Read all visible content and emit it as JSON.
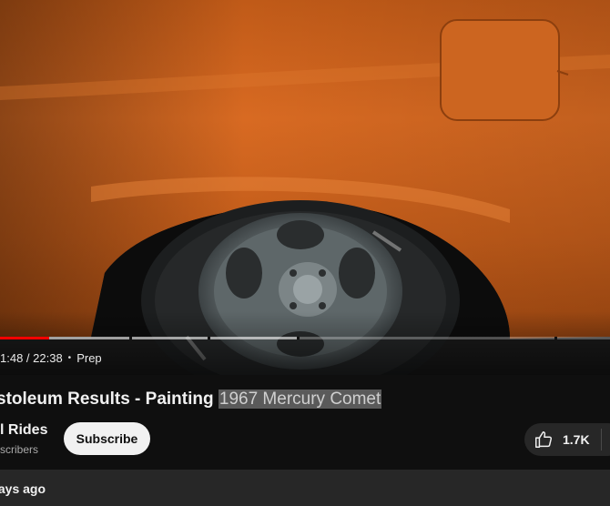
{
  "player": {
    "current_time": "1:48",
    "duration": "22:38",
    "time_display": "1:48 / 22:38",
    "chapter": "Prep",
    "progress_fraction": 0.08,
    "buffered_fraction": 0.49,
    "colors": {
      "played": "#ff0000",
      "car_paint": "#c5611c"
    }
  },
  "video": {
    "title_visible": "stoleum Results - Painting ",
    "title_highlight": "1967 Mercury Comet"
  },
  "channel": {
    "name_visible": "l Rides",
    "subscribers_visible": "scribers",
    "subscribe_label": "Subscribe"
  },
  "actions": {
    "like_count": "1.7K",
    "like_icon": "thumbs-up-icon"
  },
  "description": {
    "meta_visible": "lays ago"
  }
}
